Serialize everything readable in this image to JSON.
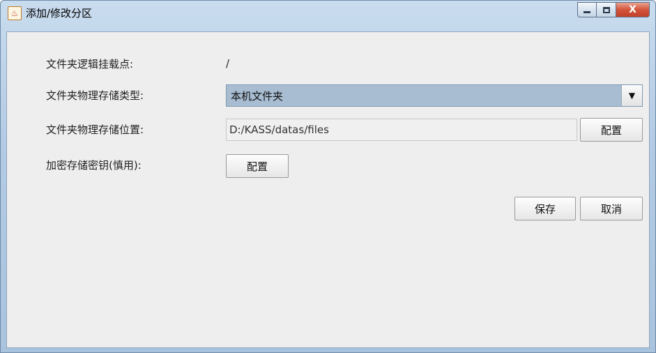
{
  "window": {
    "title": "添加/修改分区",
    "app_icon": "java-cup-icon",
    "controls": {
      "minimize": "_",
      "maximize": "□",
      "close": "X"
    }
  },
  "form": {
    "mount_point": {
      "label": "文件夹逻辑挂载点:",
      "value": "/"
    },
    "storage_type": {
      "label": "文件夹物理存储类型:",
      "selected": "本机文件夹",
      "dropdown_icon": "triangle-down-icon"
    },
    "storage_location": {
      "label": "文件夹物理存储位置:",
      "value": "D:/KASS/datas/files",
      "config_label": "配置"
    },
    "encryption_key": {
      "label": "加密存储密钥(慎用):",
      "config_label": "配置"
    }
  },
  "actions": {
    "save_label": "保存",
    "cancel_label": "取消"
  },
  "colors": {
    "combo_bg": "#a8bdd2",
    "client_bg": "#eeeeee",
    "close_button": "#c2402a"
  }
}
